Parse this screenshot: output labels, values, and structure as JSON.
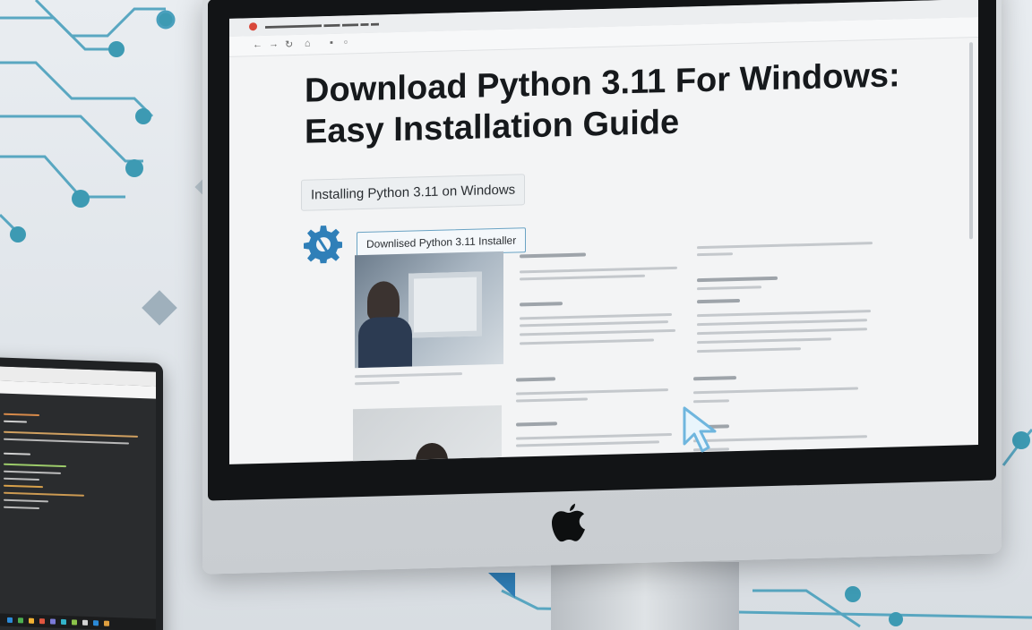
{
  "page": {
    "headline_line1": "Download Python 3.11 For Windows:",
    "headline_line2": "Easy Installation Guide",
    "subtitle": "Installing Python 3.11 on Windows",
    "button_label": "Downlised Python 3.11 Installer"
  },
  "icons": {
    "gear": "gear-icon",
    "cursor": "mouse-cursor-icon",
    "apple": "apple-logo-icon"
  },
  "colors": {
    "accent_blue": "#2f7fb8",
    "circuit_teal": "#3d9ab3",
    "cursor_blue": "#9fd0ec",
    "browser_close": "#d8473a"
  }
}
